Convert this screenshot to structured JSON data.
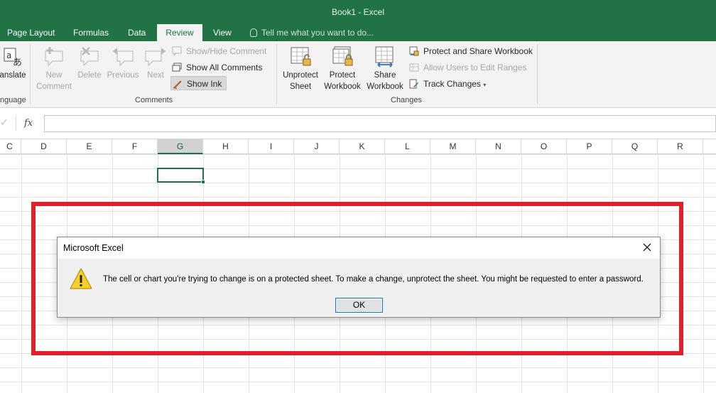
{
  "window": {
    "title": "Book1 - Excel"
  },
  "tabs": [
    {
      "label": "Page Layout"
    },
    {
      "label": "Formulas"
    },
    {
      "label": "Data"
    },
    {
      "label": "Review",
      "active": true
    },
    {
      "label": "View"
    }
  ],
  "tellme": {
    "placeholder": "Tell me what you want to do..."
  },
  "ribbon": {
    "language": {
      "translate_label": "anslate",
      "group_label": "nguage"
    },
    "comments": {
      "new_line1": "New",
      "new_line2": "Comment",
      "delete": "Delete",
      "previous": "Previous",
      "next": "Next",
      "show_hide": "Show/Hide Comment",
      "show_all": "Show All Comments",
      "show_ink": "Show Ink",
      "group_label": "Comments"
    },
    "changes": {
      "unprotect_sheet_1": "Unprotect",
      "unprotect_sheet_2": "Sheet",
      "protect_workbook_1": "Protect",
      "protect_workbook_2": "Workbook",
      "share_workbook_1": "Share",
      "share_workbook_2": "Workbook",
      "protect_share": "Protect and Share Workbook",
      "allow_users": "Allow Users to Edit Ranges",
      "track_changes": "Track Changes",
      "group_label": "Changes"
    }
  },
  "formula_bar": {
    "fx": "fx",
    "value": ""
  },
  "columns": [
    "C",
    "D",
    "E",
    "F",
    "G",
    "H",
    "I",
    "J",
    "K",
    "L",
    "M",
    "N",
    "O",
    "P",
    "Q",
    "R"
  ],
  "selected_column": "G",
  "dialog": {
    "title": "Microsoft Excel",
    "message": "The cell or chart you're trying to change is on a protected sheet. To make a change, unprotect the sheet. You might be requested to enter a password.",
    "ok_label": "OK"
  },
  "colors": {
    "excel_green": "#217346",
    "highlight_red": "#e0202a"
  }
}
